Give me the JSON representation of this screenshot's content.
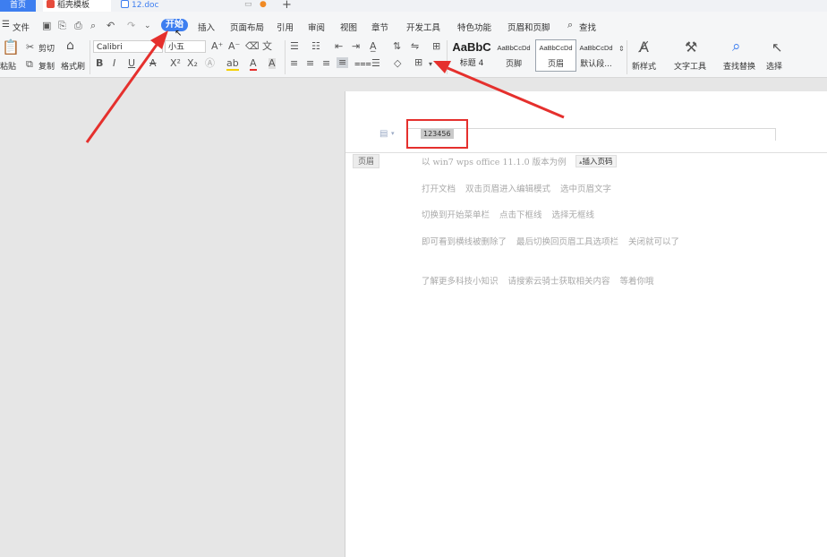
{
  "tabs": {
    "home": "首页",
    "template": "稻壳模板",
    "doc": "12.doc"
  },
  "menu": {
    "file": "文件",
    "items": [
      "开始",
      "插入",
      "页面布局",
      "引用",
      "审阅",
      "视图",
      "章节",
      "开发工具",
      "特色功能",
      "页眉和页脚"
    ],
    "search": "查找"
  },
  "ribbon": {
    "paste": "粘贴",
    "cut": "剪切",
    "copy": "复制",
    "format_painter": "格式刷",
    "font_name": "Calibri",
    "font_size": "小五",
    "styles": [
      {
        "preview": "AaBbC",
        "label": "标题 4"
      },
      {
        "preview": "AaBbCcDd",
        "label": "页脚"
      },
      {
        "preview": "AaBbCcDd",
        "label": "页眉"
      },
      {
        "preview": "AaBbCcDd",
        "label": "默认段..."
      }
    ],
    "new_style": "新样式",
    "text_tools": "文字工具",
    "find_replace": "查找替换",
    "select": "选择"
  },
  "document": {
    "header_tag": "页眉",
    "header_text": "123456",
    "insert_page_number": "插入页码",
    "lines": [
      [
        "以 win7 wps office 11.1.0 版本为例"
      ],
      [
        "打开文档",
        "双击页眉进入编辑模式",
        "选中页眉文字"
      ],
      [
        "切换到开始菜单栏",
        "点击下框线",
        "选择无框线"
      ],
      [
        "即可看到横线被删除了",
        "最后切换回页眉工具选项栏",
        "关闭就可以了"
      ],
      [
        "了解更多科技小知识",
        "请搜索云骑士获取相关内容",
        "等着你哦"
      ]
    ]
  },
  "colors": {
    "accent": "#3d7ef0",
    "annotation": "#e5302d"
  }
}
